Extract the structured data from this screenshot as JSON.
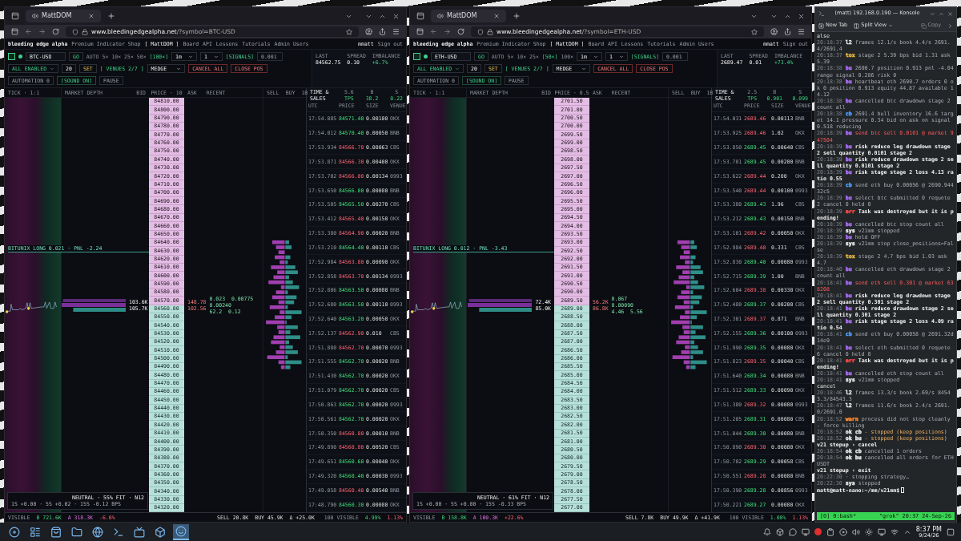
{
  "windows": [
    {
      "tab": "MattDOM",
      "url_host": "www.bleedingedgealpha.net",
      "url_path": "/?symbol=BTC-USD",
      "site_name": "bleeding edge alpha",
      "nav": [
        {
          "label": "Premium Indicator Shop",
          "selected": false
        },
        {
          "label": "[ MattDOM ]",
          "selected": true
        },
        {
          "label": "Board",
          "selected": false
        },
        {
          "label": "API",
          "selected": false
        },
        {
          "label": "Lessons",
          "selected": false
        },
        {
          "label": "Tutorials",
          "selected": false
        },
        {
          "label": "Admin Users",
          "selected": false
        }
      ],
      "user": "mmatt",
      "sign_out": "Sign out",
      "symbol": "BTC-USD",
      "go": "GO",
      "zoom_levels": [
        {
          "label": "AUTO",
          "selected": false
        },
        {
          "label": "5×",
          "selected": false
        },
        {
          "label": "10×",
          "selected": false
        },
        {
          "label": "25×",
          "selected": false
        },
        {
          "label": "50×",
          "selected": false
        },
        {
          "label": "[100×]",
          "selected": true
        }
      ],
      "interval": "1m",
      "count": "1",
      "signals": "[SIGNALS]",
      "stats": [
        {
          "label": "LAST",
          "value": "84562.75"
        },
        {
          "label": "SPREAD",
          "value": "0.10"
        },
        {
          "label": "IMBALANCE",
          "value": "+6.7%"
        }
      ],
      "quantity": "0.001",
      "venue_mode": "ALL ENABLED",
      "size": "20",
      "set": "SET",
      "venues": "[ VENUES 2/7 ]",
      "strategy": "MEDGE",
      "actions": [
        {
          "label": "CANCEL ALL",
          "kind": "danger"
        },
        {
          "label": "CLOSE POS",
          "kind": "danger"
        },
        {
          "label": "AUTOMATION 0",
          "kind": "muted"
        },
        {
          "label": "[SOUND ON]",
          "kind": "toggle"
        },
        {
          "label": "PAUSE",
          "kind": "muted"
        }
      ],
      "columns": {
        "tick": "TICK · 1:1",
        "depth": "MARKET DEPTH",
        "bid": "BID",
        "price": "PRICE · 10",
        "ask": "ASK",
        "recent": "RECENT",
        "sell": "SELL",
        "buy": "BUY",
        "interval": "1B"
      },
      "position": "BITUNIX LONG 0.021 · PNL -2.24",
      "depth_labels": [
        "103.6K",
        "105.7K"
      ],
      "recent_labels": [
        "0.023  0.00775",
        "0.00240",
        "62.2  0.12"
      ],
      "ask_labels": [
        "148.78",
        "102.56"
      ],
      "asks": [
        "84810.00",
        "84800.00",
        "84790.00",
        "84780.00",
        "84770.00",
        "84760.00",
        "84750.00",
        "84740.00",
        "84730.00",
        "84720.00",
        "84710.00",
        "84700.00",
        "84690.00",
        "84680.00",
        "84670.00",
        "84660.00",
        "84650.00",
        "84640.00",
        "84630.00",
        "84620.00",
        "84610.00",
        "84600.00",
        "84590.00",
        "84580.00",
        "84570.00"
      ],
      "bids": [
        "84560.00",
        "84550.00",
        "84540.00",
        "84530.00",
        "84520.00",
        "84510.00",
        "84500.00",
        "84490.00",
        "84480.00",
        "84470.00",
        "84460.00",
        "84450.00",
        "84440.00",
        "84430.00",
        "84420.00",
        "84410.00",
        "84400.00",
        "84390.00",
        "84380.00",
        "84370.00",
        "84360.00",
        "84350.00",
        "84340.00",
        "84330.00",
        "84320.00"
      ],
      "sales_title": "TIME & SALES",
      "sales_stats": [
        {
          "label": "5.6",
          "sub": "TPS"
        },
        {
          "label": "B",
          "sub": "38.2"
        },
        {
          "label": "S",
          "sub": "0.22"
        }
      ],
      "sales_columns": [
        "UTC",
        "PRICE",
        "SIZE",
        "VENUE"
      ],
      "sales": [
        {
          "time": "17:54.085",
          "price": "84571.40",
          "size": "0.00100",
          "venue": "OKX",
          "buy": true
        },
        {
          "time": "17:54.012",
          "price": "84570.40",
          "size": "0.00050",
          "venue": "BNB",
          "buy": true
        },
        {
          "time": "17:53.934",
          "price": "84566.70",
          "size": "0.00063",
          "venue": "CBS",
          "buy": false
        },
        {
          "time": "17:53.871",
          "price": "84566.30",
          "size": "0.00400",
          "venue": "OKX",
          "buy": false
        },
        {
          "time": "17:53.702",
          "price": "84566.00",
          "size": "0.00134",
          "venue": "0993",
          "buy": false
        },
        {
          "time": "17:53.650",
          "price": "84566.00",
          "size": "0.00080",
          "venue": "BNB",
          "buy": true
        },
        {
          "time": "17:53.505",
          "price": "84565.50",
          "size": "0.00270",
          "venue": "CBS",
          "buy": true
        },
        {
          "time": "17:53.412",
          "price": "84565.40",
          "size": "0.00150",
          "venue": "OKX",
          "buy": false
        },
        {
          "time": "17:53.380",
          "price": "84564.90",
          "size": "0.00020",
          "venue": "BNB",
          "buy": false
        },
        {
          "time": "17:53.210",
          "price": "84564.40",
          "size": "0.00110",
          "venue": "CBS",
          "buy": true
        },
        {
          "time": "17:52.984",
          "price": "84563.80",
          "size": "0.00090",
          "venue": "OKX",
          "buy": false
        },
        {
          "time": "17:52.858",
          "price": "84563.70",
          "size": "0.00134",
          "venue": "0993",
          "buy": false
        },
        {
          "time": "17:52.806",
          "price": "84563.50",
          "size": "0.00080",
          "venue": "BNB",
          "buy": true
        },
        {
          "time": "17:52.680",
          "price": "84563.50",
          "size": "0.00110",
          "venue": "0993",
          "buy": true
        },
        {
          "time": "17:52.640",
          "price": "84563.20",
          "size": "0.00050",
          "venue": "OKX",
          "buy": true
        },
        {
          "time": "17:52.137",
          "price": "84562.90",
          "size": "0.010",
          "venue": "CBS",
          "buy": false
        },
        {
          "time": "17:51.880",
          "price": "84562.70",
          "size": "0.00070",
          "venue": "0993",
          "buy": false
        },
        {
          "time": "17:51.555",
          "price": "84562.70",
          "size": "0.00020",
          "venue": "BNB",
          "buy": true
        },
        {
          "time": "17:51.430",
          "price": "84562.70",
          "size": "0.00020",
          "venue": "OKX",
          "buy": true
        },
        {
          "time": "17:51.079",
          "price": "84562.70",
          "size": "0.00020",
          "venue": "CBS",
          "buy": true
        },
        {
          "time": "17:50.863",
          "price": "84562.70",
          "size": "0.00020",
          "venue": "0993",
          "buy": true
        },
        {
          "time": "17:50.561",
          "price": "84562.70",
          "size": "0.00020",
          "venue": "OKX",
          "buy": true
        },
        {
          "time": "17:50.350",
          "price": "84560.80",
          "size": "0.00010",
          "venue": "BNB",
          "buy": false
        },
        {
          "time": "17:49.890",
          "price": "84560.80",
          "size": "0.00520",
          "venue": "CBS",
          "buy": false
        },
        {
          "time": "17:49.651",
          "price": "84560.60",
          "size": "0.00040",
          "venue": "OKX",
          "buy": true
        },
        {
          "time": "17:49.320",
          "price": "84560.40",
          "size": "0.00030",
          "venue": "0993",
          "buy": true
        },
        {
          "time": "17:49.058",
          "price": "84560.40",
          "size": "0.00540",
          "venue": "BNB",
          "buy": false
        },
        {
          "time": "17:48.790",
          "price": "84560.30",
          "size": "0.00080",
          "venue": "OKX",
          "buy": true
        }
      ],
      "regime": "NEUTRAL · 55% FIT · N12",
      "regime_detail": "1S +0.00 · 5S +0.02 · 15S -0.12 BPS",
      "footer": {
        "visible": "VISIBLE",
        "bid_total": "B 721.6K",
        "ask_total": "A 318.3K",
        "imbalance": "-6.0%",
        "sell": "SELL 20.8K",
        "buy": "BUY 45.9K",
        "delta": "Δ +25.0K",
        "sales_visible": "100 VISIBLE",
        "sales_buy": "4.99%",
        "sales_sell": "1.13%"
      }
    },
    {
      "tab": "MattDOM",
      "url_host": "www.bleedingedgealpha.net",
      "url_path": "/?symbol=ETH-USD",
      "site_name": "bleeding edge alpha",
      "nav": [
        {
          "label": "Premium Indicator Shop",
          "selected": false
        },
        {
          "label": "[ MattDOM ]",
          "selected": true
        },
        {
          "label": "Board",
          "selected": false
        },
        {
          "label": "API",
          "selected": false
        },
        {
          "label": "Lessons",
          "selected": false
        },
        {
          "label": "Tutorials",
          "selected": false
        },
        {
          "label": "Admin Users",
          "selected": false
        }
      ],
      "user": "mmatt",
      "sign_out": "Sign out",
      "symbol": "ETH-USD",
      "go": "GO",
      "zoom_levels": [
        {
          "label": "AUTO",
          "selected": false
        },
        {
          "label": "5×",
          "selected": false
        },
        {
          "label": "10×",
          "selected": false
        },
        {
          "label": "25×",
          "selected": false
        },
        {
          "label": "[50×]",
          "selected": true
        },
        {
          "label": "100×",
          "selected": false
        }
      ],
      "interval": "1m",
      "count": "1",
      "signals": "[SIGNALS]",
      "stats": [
        {
          "label": "LAST",
          "value": "2689.47"
        },
        {
          "label": "SPREAD",
          "value": "0.01"
        },
        {
          "label": "IMBALANCE",
          "value": "+73.4%"
        }
      ],
      "quantity": "0.001",
      "venue_mode": "ALL ENABLED",
      "size": "20",
      "set": "SET",
      "venues": "[ VENUES 2/7 ]",
      "strategy": "MEDGE",
      "actions": [
        {
          "label": "CANCEL ALL",
          "kind": "danger"
        },
        {
          "label": "CLOSE POS",
          "kind": "danger"
        },
        {
          "label": "AUTOMATION 0",
          "kind": "muted"
        },
        {
          "label": "[SOUND ON]",
          "kind": "toggle"
        },
        {
          "label": "PAUSE",
          "kind": "muted"
        }
      ],
      "columns": {
        "tick": "TICK · 1:1",
        "depth": "MARKET DEPTH",
        "bid": "BID",
        "price": "PRICE · 0.5",
        "ask": "ASK",
        "recent": "RECENT",
        "sell": "SELL",
        "buy": "BUY",
        "interval": "1B"
      },
      "position": "BITUNIX LONG 0.012 · PNL -3.43",
      "depth_labels": [
        "72.4K",
        "85.0K"
      ],
      "recent_labels": [
        "0.067",
        "0.00090",
        "4.46  5.56"
      ],
      "ask_labels": [
        "56.2K",
        "86.8K"
      ],
      "asks": [
        "2701.50",
        "2701.00",
        "2700.50",
        "2700.00",
        "2699.50",
        "2699.00",
        "2698.50",
        "2698.00",
        "2697.50",
        "2697.00",
        "2696.50",
        "2696.00",
        "2695.50",
        "2695.00",
        "2694.50",
        "2694.00",
        "2693.50",
        "2693.00",
        "2692.50",
        "2692.00",
        "2691.50",
        "2691.00",
        "2690.50",
        "2690.00",
        "2689.50"
      ],
      "bids": [
        "2689.00",
        "2688.50",
        "2688.00",
        "2687.50",
        "2687.00",
        "2686.50",
        "2686.00",
        "2685.50",
        "2685.00",
        "2684.50",
        "2684.00",
        "2683.50",
        "2683.00",
        "2682.50",
        "2682.00",
        "2681.50",
        "2681.00",
        "2680.50",
        "2680.00",
        "2679.50",
        "2679.00",
        "2678.50",
        "2678.00",
        "2677.50",
        "2677.00"
      ],
      "sales_title": "TIME & SALES",
      "sales_stats": [
        {
          "label": "2.5",
          "sub": "TPS"
        },
        {
          "label": "B",
          "sub": "0.901"
        },
        {
          "label": "S",
          "sub": "0.099"
        }
      ],
      "sales_columns": [
        "UTC",
        "PRICE",
        "SIZE",
        "VENUE"
      ],
      "sales": [
        {
          "time": "17:54.031",
          "price": "2689.46",
          "size": "0.00113",
          "venue": "BNB",
          "buy": false
        },
        {
          "time": "17:53.925",
          "price": "2689.46",
          "size": "1.02",
          "venue": "OKX",
          "buy": false
        },
        {
          "time": "17:53.850",
          "price": "2689.45",
          "size": "0.00640",
          "venue": "CBS",
          "buy": true
        },
        {
          "time": "17:53.701",
          "price": "2689.45",
          "size": "0.00200",
          "venue": "BNB",
          "buy": true
        },
        {
          "time": "17:53.622",
          "price": "2689.44",
          "size": "0.200",
          "venue": "OKX",
          "buy": false
        },
        {
          "time": "17:53.540",
          "price": "2689.44",
          "size": "0.00100",
          "venue": "0993",
          "buy": false
        },
        {
          "time": "17:53.380",
          "price": "2689.43",
          "size": "1.96",
          "venue": "CBS",
          "buy": true
        },
        {
          "time": "17:53.212",
          "price": "2689.43",
          "size": "0.00150",
          "venue": "BNB",
          "buy": true
        },
        {
          "time": "17:53.101",
          "price": "2689.42",
          "size": "0.00050",
          "venue": "OKX",
          "buy": false
        },
        {
          "time": "17:52.984",
          "price": "2689.40",
          "size": "0.331",
          "venue": "CBS",
          "buy": false
        },
        {
          "time": "17:52.830",
          "price": "2689.40",
          "size": "0.00080",
          "venue": "0993",
          "buy": true
        },
        {
          "time": "17:52.715",
          "price": "2689.39",
          "size": "1.00",
          "venue": "BNB",
          "buy": true
        },
        {
          "time": "17:52.604",
          "price": "2689.38",
          "size": "0.00330",
          "venue": "OKX",
          "buy": false
        },
        {
          "time": "17:52.480",
          "price": "2689.37",
          "size": "0.00200",
          "venue": "CBS",
          "buy": true
        },
        {
          "time": "17:52.301",
          "price": "2689.37",
          "size": "0.871",
          "venue": "BNB",
          "buy": false
        },
        {
          "time": "17:52.155",
          "price": "2689.36",
          "size": "0.00100",
          "venue": "0993",
          "buy": true
        },
        {
          "time": "17:51.990",
          "price": "2689.35",
          "size": "0.00080",
          "venue": "OKX",
          "buy": true
        },
        {
          "time": "17:51.823",
          "price": "2689.35",
          "size": "0.00040",
          "venue": "CBS",
          "buy": false
        },
        {
          "time": "17:51.640",
          "price": "2689.34",
          "size": "0.00080",
          "venue": "BNB",
          "buy": true
        },
        {
          "time": "17:51.512",
          "price": "2689.33",
          "size": "0.00090",
          "venue": "OKX",
          "buy": true
        },
        {
          "time": "17:51.380",
          "price": "2689.32",
          "size": "0.00080",
          "venue": "0993",
          "buy": false
        },
        {
          "time": "17:51.205",
          "price": "2689.31",
          "size": "0.00080",
          "venue": "CBS",
          "buy": true
        },
        {
          "time": "17:51.044",
          "price": "2689.30",
          "size": "0.00080",
          "venue": "BNB",
          "buy": true
        },
        {
          "time": "17:50.890",
          "price": "2689.30",
          "size": "0.00080",
          "venue": "OKX",
          "buy": false
        },
        {
          "time": "17:50.702",
          "price": "2689.29",
          "size": "0.00058",
          "venue": "CBS",
          "buy": true
        },
        {
          "time": "17:50.551",
          "price": "2689.28",
          "size": "0.00080",
          "venue": "BNB",
          "buy": false
        },
        {
          "time": "17:50.390",
          "price": "2689.28",
          "size": "0.00856",
          "venue": "0993",
          "buy": true
        },
        {
          "time": "17:50.221",
          "price": "2689.27",
          "size": "0.00080",
          "venue": "OKX",
          "buy": true
        }
      ],
      "regime": "NEUTRAL · 61% FIT · N12",
      "regime_detail": "1S +0.00 · 5S +0.00 · 15S -0.33 BPS",
      "footer": {
        "visible": "VISIBLE",
        "bid_total": "B 158.8K",
        "ask_total": "A 100.3K",
        "imbalance": "+22.6%",
        "sell": "SELL 7.8K",
        "buy": "BUY 49.9K",
        "delta": "Δ +41.9K",
        "sales_visible": "100 VISIBLE",
        "sales_buy": "1.00%",
        "sales_sell": "1.13%"
      }
    }
  ],
  "terminal": {
    "title": "(matt) 192.168.0.190 — Konsole",
    "new_tab": "New Tab",
    "split_view": "Split View",
    "copy": "Copy",
    "lines": [
      {
        "kind": "plain",
        "text": "alse"
      },
      {
        "kind": "info",
        "time": "20:18:37",
        "tag": "l2",
        "color": "#e6e6e6",
        "text": "frames 12.1/s book 4.4/s 2691.4/2691.4"
      },
      {
        "kind": "info",
        "time": "20:18:37",
        "tag": "tox",
        "color": "#e8b840",
        "text": "stage 2 5.39 bps bid 1.31 ask 5.39"
      },
      {
        "kind": "info",
        "time": "20:18:38",
        "tag": "bu",
        "color": "#b070ff",
        "text": "2690.7 position 0.913 pnl -4.04 range signal 0.286 risk 0"
      },
      {
        "kind": "info",
        "time": "20:18:38",
        "tag": "bu",
        "color": "#b070ff",
        "text": "heartbeat eth 2690.7 orders 0 ok 0 position 0.913 equity 44.87 available 14.12"
      },
      {
        "kind": "info",
        "time": "20:18:38",
        "tag": "bu",
        "color": "#b070ff",
        "text": "cancelled btc drawdown stage 2 count all"
      },
      {
        "kind": "info",
        "time": "20:18:38",
        "tag": "cb",
        "color": "#4aa0ff",
        "text": "2691.4 bull inventory 16.6 target 14.1 pressure 0.34 bid on ask on signal 0.518 reducing"
      },
      {
        "kind": "alert",
        "time": "20:18:39",
        "tag": "bu",
        "color": "#b070ff",
        "text": "send btc sell 0.0101 @ market 947504"
      },
      {
        "kind": "emphasis",
        "time": "20:18:39",
        "tag": "bu",
        "color": "#b070ff",
        "text": "risk reduce leg drawdown stage 2 sell quantity 0.0101 stage 2"
      },
      {
        "kind": "emphasis",
        "time": "20:18:39",
        "tag": "bu",
        "color": "#b070ff",
        "text": "risk reduce drawdown stage 2 sell quantity 0.0101 stage 2"
      },
      {
        "kind": "emphasis",
        "time": "20:18:39",
        "tag": "bu",
        "color": "#b070ff",
        "text": "risk stage stage 2 loss 4.13 ratio 0.55"
      },
      {
        "kind": "info",
        "time": "20:18:39",
        "tag": "cb",
        "color": "#4aa0ff",
        "text": "send eth buy 0.00056 @ 2690.94432c5"
      },
      {
        "kind": "info",
        "time": "20:18:39",
        "tag": "bu",
        "color": "#b070ff",
        "text": "select btc submitted 0 requote 2 cancel 0 held 0"
      },
      {
        "kind": "emphasis",
        "time": "20:18:39",
        "tag": "err",
        "color": "#ff4a4a",
        "text": "Task was destroyed but it is pending!"
      },
      {
        "kind": "info",
        "time": "20:18:39",
        "tag": "bu",
        "color": "#b070ff",
        "text": "cancelled btc stop count all"
      },
      {
        "kind": "info",
        "time": "20:18:39",
        "tag": "sys",
        "color": "#e6e6e6",
        "text": "v21mm stopped"
      },
      {
        "kind": "info",
        "time": "20:18:39",
        "tag": "bu",
        "color": "#b070ff",
        "text": "hold OFF"
      },
      {
        "kind": "info",
        "time": "20:18:39",
        "tag": "sys",
        "color": "#e6e6e6",
        "text": "v21mm stop close_positions=False"
      },
      {
        "kind": "info",
        "time": "20:18:39",
        "tag": "tox",
        "color": "#e8b840",
        "text": "stage 2 4.7 bps bid 1.03 ask 4.7"
      },
      {
        "kind": "info",
        "time": "20:18:40",
        "tag": "bu",
        "color": "#b070ff",
        "text": "cancelled eth drawdown stage 2 count all"
      },
      {
        "kind": "alert",
        "time": "20:18:41",
        "tag": "bu",
        "color": "#b070ff",
        "text": "send eth sell 0.301 @ market 638208"
      },
      {
        "kind": "emphasis",
        "time": "20:18:41",
        "tag": "bu",
        "color": "#b070ff",
        "text": "risk reduce leg drawdown stage 2 sell quantity 0.301 stage 2"
      },
      {
        "kind": "emphasis",
        "time": "20:18:41",
        "tag": "bu",
        "color": "#b070ff",
        "text": "risk reduce drawdown stage 2 sell quantity 0.301 stage 2"
      },
      {
        "kind": "emphasis",
        "time": "20:18:41",
        "tag": "bu",
        "color": "#b070ff",
        "text": "risk stage stage 2 loss 4.09 ratio 0.54"
      },
      {
        "kind": "info",
        "time": "20:18:41",
        "tag": "cb",
        "color": "#4aa0ff",
        "text": "send eth buy 0.00058 @ 2691.32d14e9"
      },
      {
        "kind": "info",
        "time": "20:18:41",
        "tag": "bu",
        "color": "#b070ff",
        "text": "select eth submitted 0 requote 6 cancel 0 held 0"
      },
      {
        "kind": "emphasis",
        "time": "20:18:41",
        "tag": "err",
        "color": "#ff4a4a",
        "text": "Task was destroyed but it is pending!"
      },
      {
        "kind": "info",
        "time": "20:18:41",
        "tag": "bu",
        "color": "#b070ff",
        "text": "cancelled eth stop count all"
      },
      {
        "kind": "info",
        "time": "20:18:41",
        "tag": "sys",
        "color": "#e6e6e6",
        "text": "v21mm stopped"
      },
      {
        "kind": "plain",
        "text": "cancel"
      },
      {
        "kind": "info",
        "time": "20:18:46",
        "tag": "l2",
        "color": "#e6e6e6",
        "text": "frames 13.3/s book 2.69/s 84543.3/84543.3"
      },
      {
        "kind": "info",
        "time": "20:18:47",
        "tag": "l2",
        "color": "#e6e6e6",
        "text": "frames 11.6/s book 2.4/s 2691.0/2691.0"
      },
      {
        "kind": "info",
        "time": "20:18:52",
        "tag": "warn",
        "color": "#ff8a30",
        "text": "process did not stop cleanly - force killing"
      },
      {
        "kind": "notice",
        "time": "20:18:52",
        "tag": "ok cb",
        "color": "#e6e6e6",
        "text": "- stopped (keep positions)"
      },
      {
        "kind": "notice",
        "time": "20:18:52",
        "tag": "ok bu",
        "color": "#e6e6e6",
        "text": "- stopped (keep positions)"
      },
      {
        "kind": "prompt",
        "text": "v21 stepup › cancel"
      },
      {
        "kind": "info",
        "time": "20:18:54",
        "tag": "ok cb",
        "color": "#e6e6e6",
        "text": "cancelled 1 orders"
      },
      {
        "kind": "info",
        "time": "20:18:54",
        "tag": "ok bu",
        "color": "#e6e6e6",
        "text": "cancelled all orders for ETHUSDT"
      },
      {
        "kind": "prompt",
        "text": "v21 stepup › exit"
      },
      {
        "kind": "info",
        "time": "20:22:30",
        "text": "· stopping strategy…"
      },
      {
        "kind": "info",
        "time": "20:22:30",
        "tag": "sys",
        "color": "#e6e6e6",
        "text": "stopped"
      },
      {
        "kind": "shell",
        "text": "matt@matt-nano:~/mm/v21mm$"
      }
    ],
    "status": {
      "window": "[0] 0:bash*",
      "host": "\"grok\" 20:37 24-Sep-26"
    }
  },
  "taskbar": {
    "apps": [
      {
        "kind": "launcher",
        "selected": false
      },
      {
        "kind": "tasks",
        "selected": false
      },
      {
        "kind": "store",
        "selected": false
      },
      {
        "kind": "files",
        "selected": false
      },
      {
        "kind": "browser",
        "selected": false
      },
      {
        "kind": "terminal",
        "selected": false
      },
      {
        "kind": "tv",
        "selected": false
      },
      {
        "kind": "cube",
        "selected": false
      },
      {
        "kind": "face",
        "selected": true
      }
    ],
    "clock": {
      "time": "8:37 PM",
      "date": "9/24/26"
    }
  }
}
